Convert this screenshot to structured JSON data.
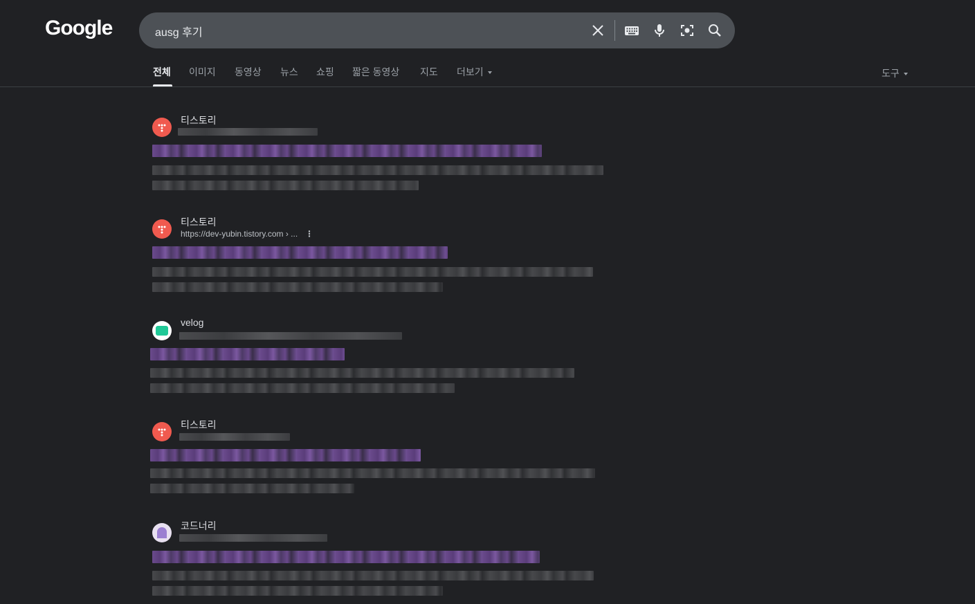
{
  "header": {
    "logo": "Google",
    "search": {
      "value": "ausg 후기",
      "placeholder": ""
    }
  },
  "tabs": [
    {
      "label": "전체",
      "active": true
    },
    {
      "label": "이미지"
    },
    {
      "label": "동영상"
    },
    {
      "label": "뉴스"
    },
    {
      "label": "쇼핑"
    },
    {
      "label": "짧은 동영상"
    },
    {
      "label": "지도"
    },
    {
      "label": "더보기"
    }
  ],
  "tools_label": "도구",
  "results": [
    {
      "site": "티스토리",
      "url": "",
      "favicon": "tistory-icon",
      "favicon_color": "#f05a4f"
    },
    {
      "site": "티스토리",
      "url": "https://dev-yubin.tistory.com › ...",
      "favicon": "tistory-icon",
      "favicon_color": "#f05a4f"
    },
    {
      "site": "velog",
      "url": "",
      "favicon": "velog-icon",
      "favicon_color": "#20c997"
    },
    {
      "site": "티스토리",
      "url": "",
      "favicon": "tistory-icon",
      "favicon_color": "#f05a4f"
    },
    {
      "site": "코드너리",
      "url": "",
      "favicon": "codenary-icon",
      "favicon_color": "#e8e0f0"
    }
  ],
  "colors": {
    "background": "#202124",
    "searchbox": "#4d5156",
    "title_blur": "#6a4a8c"
  }
}
